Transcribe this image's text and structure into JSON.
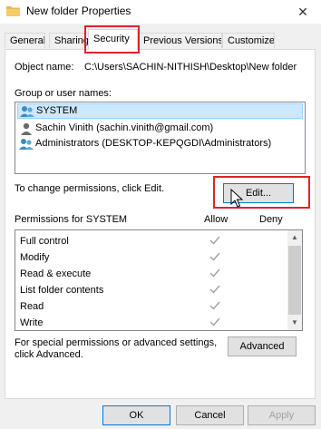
{
  "window": {
    "title": "New folder Properties",
    "close_glyph": "✕"
  },
  "tabs": [
    {
      "label": "General"
    },
    {
      "label": "Sharing"
    },
    {
      "label": "Security"
    },
    {
      "label": "Previous Versions"
    },
    {
      "label": "Customize"
    }
  ],
  "security": {
    "object_name_label": "Object name:",
    "object_name_value": "C:\\Users\\SACHIN-NITHISH\\Desktop\\New folder",
    "group_label": "Group or user names:",
    "users": [
      {
        "name": "SYSTEM",
        "selected": true
      },
      {
        "name": "Sachin Vinith (sachin.vinith@gmail.com)",
        "selected": false
      },
      {
        "name": "Administrators (DESKTOP-KEPQGDI\\Administrators)",
        "selected": false
      }
    ],
    "change_hint": "To change permissions, click Edit.",
    "edit_button": "Edit...",
    "permissions_for": "Permissions for SYSTEM",
    "allow_header": "Allow",
    "deny_header": "Deny",
    "permissions": [
      {
        "name": "Full control",
        "allow": true,
        "deny": false
      },
      {
        "name": "Modify",
        "allow": true,
        "deny": false
      },
      {
        "name": "Read & execute",
        "allow": true,
        "deny": false
      },
      {
        "name": "List folder contents",
        "allow": true,
        "deny": false
      },
      {
        "name": "Read",
        "allow": true,
        "deny": false
      },
      {
        "name": "Write",
        "allow": true,
        "deny": false
      }
    ],
    "special_hint_line1": "For special permissions or advanced settings,",
    "special_hint_line2": "click Advanced.",
    "advanced_button": "Advanced"
  },
  "footer": {
    "ok": "OK",
    "cancel": "Cancel",
    "apply": "Apply"
  },
  "colors": {
    "highlight": "#e0222a",
    "selection": "#cce8ff",
    "check_disabled": "#a0a0a0"
  }
}
